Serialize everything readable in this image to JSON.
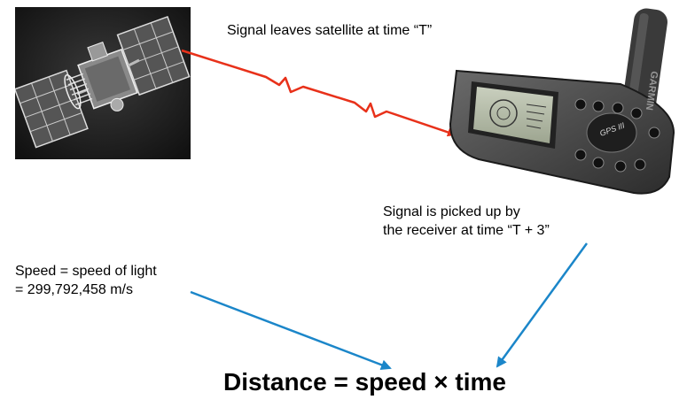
{
  "labels": {
    "leaves": "Signal leaves satellite at time “T”",
    "picked_line1": "Signal is picked up by",
    "picked_line2": "the receiver at time “T + 3”",
    "speed_line1": "Speed = speed of light",
    "speed_line2": "= 299,792,458 m/s",
    "formula": "Distance = speed × time"
  },
  "receiver": {
    "brand": "GARMIN",
    "badge": "GPS III"
  },
  "colors": {
    "signal_arrow": "#e8311a",
    "formula_arrows": "#1b86c9",
    "text": "#000000"
  },
  "icons": {
    "satellite": "gps-satellite-icon",
    "receiver": "handheld-gps-receiver-icon"
  }
}
